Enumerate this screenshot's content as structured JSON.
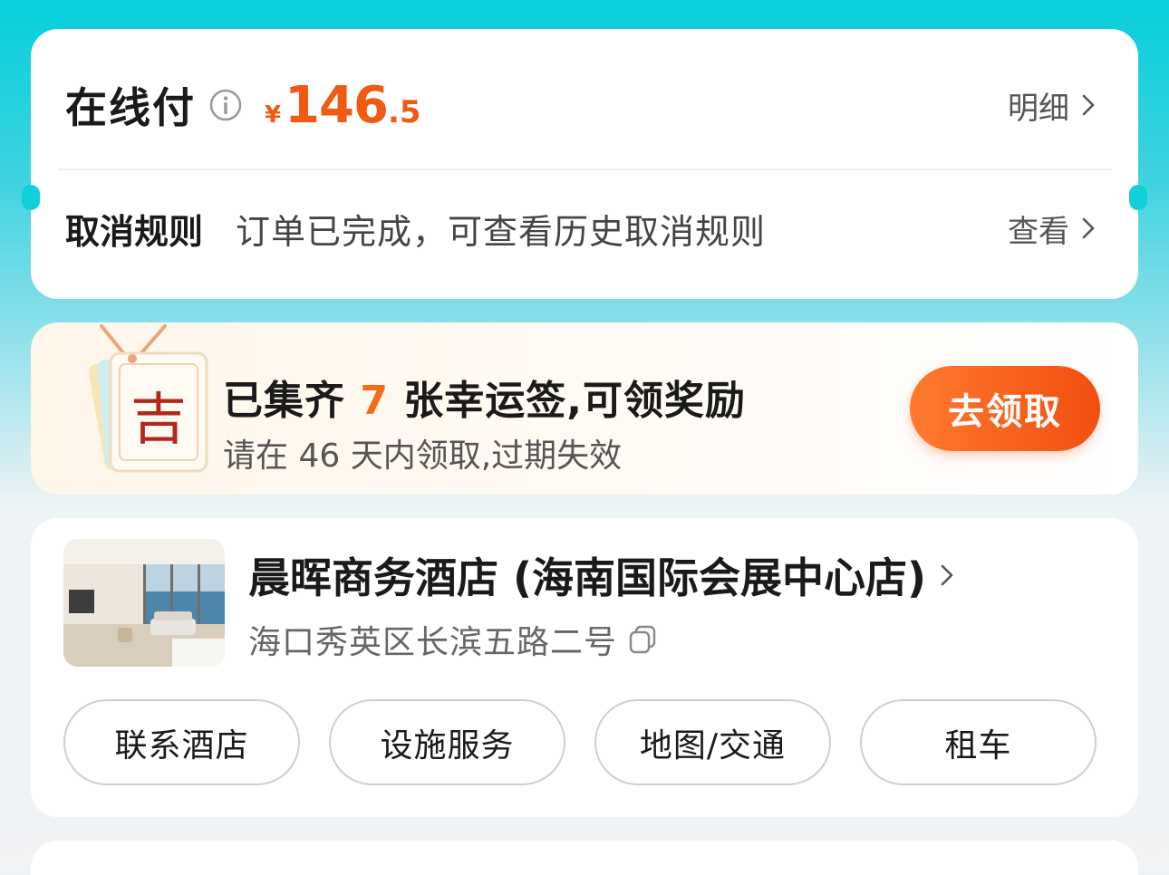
{
  "payment": {
    "title": "在线付",
    "info_icon": "info-circle-icon",
    "currency": "¥",
    "price_int": "146",
    "price_dec": ".5",
    "detail_label": "明细",
    "cancel_label": "取消规则",
    "cancel_text": "订单已完成，可查看历史取消规则",
    "view_label": "查看"
  },
  "lucky": {
    "tag_char": "吉",
    "title_prefix": "已集齐",
    "count": "7",
    "title_suffix": "张幸运签,可领奖励",
    "subtitle": "请在 46 天内领取,过期失效",
    "claim_button": "去领取"
  },
  "hotel": {
    "name": "晨晖商务酒店 (海南国际会展中心店)",
    "address": "海口秀英区长滨五路二号",
    "buttons": [
      "联系酒店",
      "设施服务",
      "地图/交通",
      "租车"
    ]
  },
  "colors": {
    "accent": "#f05a13",
    "background_top": "#07cfdc",
    "card": "#ffffff"
  }
}
